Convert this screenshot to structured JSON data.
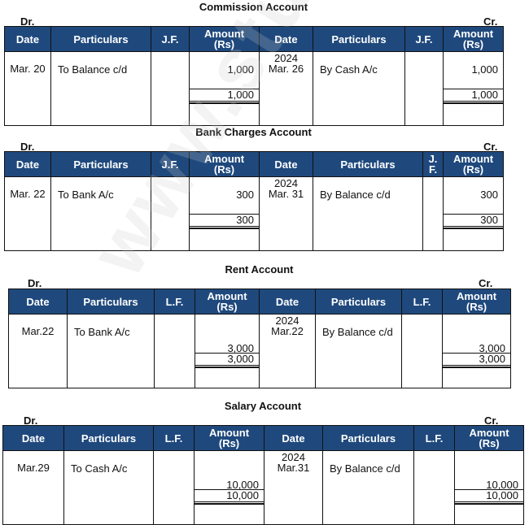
{
  "watermark": "www.studiestoday.com",
  "labels": {
    "dr": "Dr.",
    "cr": "Cr."
  },
  "accounts": [
    {
      "title": "Commission Account",
      "headers": [
        "Date",
        "Particulars",
        "J.F.",
        "Amount (Rs)",
        "Date",
        "Particulars",
        "J.F.",
        "Amount (Rs)"
      ],
      "debit": {
        "date": "Mar. 20",
        "particulars": "To Balance c/d",
        "ref": "",
        "amount": "1,000",
        "total": "1,000"
      },
      "credit": {
        "year": "2024",
        "date": "Mar. 26",
        "particulars": "By Cash A/c",
        "ref": "",
        "amount": "1,000",
        "total": "1,000"
      }
    },
    {
      "title": "Bank Charges Account",
      "headers": [
        "Date",
        "Particulars",
        "J.F.",
        "Amount (Rs)",
        "Date",
        "Particulars",
        "J. F.",
        "Amount (Rs)"
      ],
      "debit": {
        "date": "Mar. 22",
        "particulars": "To Bank A/c",
        "ref": "",
        "amount": "300",
        "total": "300"
      },
      "credit": {
        "year": "2024",
        "date": "Mar. 31",
        "particulars": "By Balance c/d",
        "ref": "",
        "amount": "300",
        "total": "300"
      }
    },
    {
      "title": "Rent Account",
      "headers": [
        "Date",
        "Particulars",
        "L.F.",
        "Amount (Rs)",
        "Date",
        "Particulars",
        "L.F.",
        "Amount (Rs)"
      ],
      "debit": {
        "date": "Mar.22",
        "particulars": "To Bank A/c",
        "ref": "",
        "amount": "3,000",
        "total": "3,000"
      },
      "credit": {
        "year": "2024",
        "date": "Mar.22",
        "particulars": "By Balance c/d",
        "ref": "",
        "amount": "3,000",
        "total": "3,000"
      }
    },
    {
      "title": "Salary Account",
      "headers": [
        "Date",
        "Particulars",
        "L.F.",
        "Amount (Rs)",
        "Date",
        "Particulars",
        "L.F.",
        "Amount (Rs)"
      ],
      "debit": {
        "date": "Mar.29",
        "particulars": "To Cash A/c",
        "ref": "",
        "amount": "10,000",
        "total": "10,000"
      },
      "credit": {
        "year": "2024",
        "date": "Mar.31",
        "particulars": "By Balance c/d",
        "ref": "",
        "amount": "10,000",
        "total": "10,000"
      }
    }
  ]
}
